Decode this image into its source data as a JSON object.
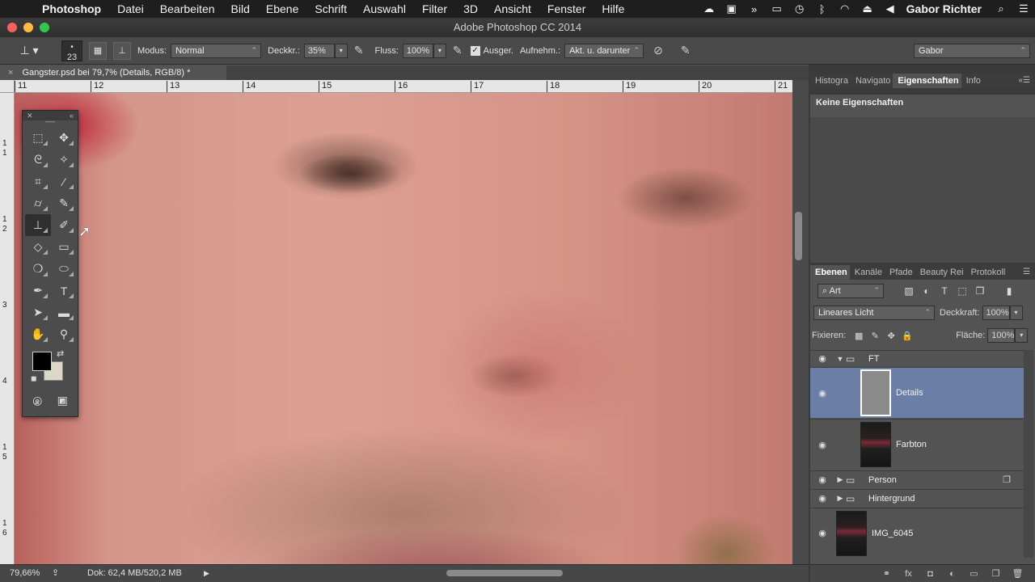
{
  "menubar": {
    "app": "Photoshop",
    "items": [
      "Datei",
      "Bearbeiten",
      "Bild",
      "Ebene",
      "Schrift",
      "Auswahl",
      "Filter",
      "3D",
      "Ansicht",
      "Fenster",
      "Hilfe"
    ],
    "username": "Gabor Richter",
    "status_icons": [
      "creative-cloud-icon",
      "display-icon",
      "forward-icon",
      "airplay-icon",
      "time-machine-icon",
      "bluetooth-icon",
      "wifi-icon",
      "eject-icon",
      "volume-icon",
      "spotlight-icon",
      "notification-list-icon"
    ]
  },
  "window": {
    "title": "Adobe Photoshop CC 2014"
  },
  "options": {
    "brush_size": "23",
    "mode_label": "Modus:",
    "mode_value": "Normal",
    "opacity_label": "Deckkr.:",
    "opacity_value": "35%",
    "flow_label": "Fluss:",
    "flow_value": "100%",
    "aligned_label": "Ausger.",
    "aligned_checked": true,
    "sample_label": "Aufnehm.:",
    "sample_value": "Akt. u. darunter",
    "workspace": "Gabor"
  },
  "document": {
    "tab_title": "Gangster.psd bei 79,7% (Details, RGB/8) *",
    "ruler_h": [
      "11",
      "12",
      "13",
      "14",
      "15",
      "16",
      "17",
      "18",
      "19",
      "20",
      "21"
    ],
    "ruler_v": [
      "1",
      "1",
      "1",
      "2",
      "3",
      "4",
      "1",
      "5",
      "1",
      "6"
    ]
  },
  "status": {
    "zoom": "79,66%",
    "doc": "Dok: 62,4 MB/520,2 MB"
  },
  "panels": {
    "top_tabs": [
      "Histogra",
      "Navigato",
      "Eigenschaften",
      "Info"
    ],
    "top_active": "Eigenschaften",
    "properties_title": "Keine Eigenschaften",
    "layer_tabs": [
      "Ebenen",
      "Kanäle",
      "Pfade",
      "Beauty Rei",
      "Protokoll"
    ],
    "layer_tab_active": "Ebenen",
    "kind_filter": "Art",
    "blend_mode": "Lineares Licht",
    "opacity_label": "Deckkraft:",
    "opacity_value": "100%",
    "lock_label": "Fixieren:",
    "fill_label": "Fläche:",
    "fill_value": "100%",
    "layers": [
      {
        "name": "FT",
        "type": "group",
        "expanded": true
      },
      {
        "name": "Details",
        "type": "layer",
        "selected": true
      },
      {
        "name": "Farbton",
        "type": "layer"
      },
      {
        "name": "Person",
        "type": "group",
        "expanded": false
      },
      {
        "name": "Hintergrund",
        "type": "group",
        "expanded": false
      },
      {
        "name": "IMG_6045",
        "type": "layer"
      }
    ]
  },
  "colors": {
    "foreground": "#000000",
    "background": "#dcd7c6",
    "selection": "#6a7fa5",
    "panel": "#535353"
  }
}
